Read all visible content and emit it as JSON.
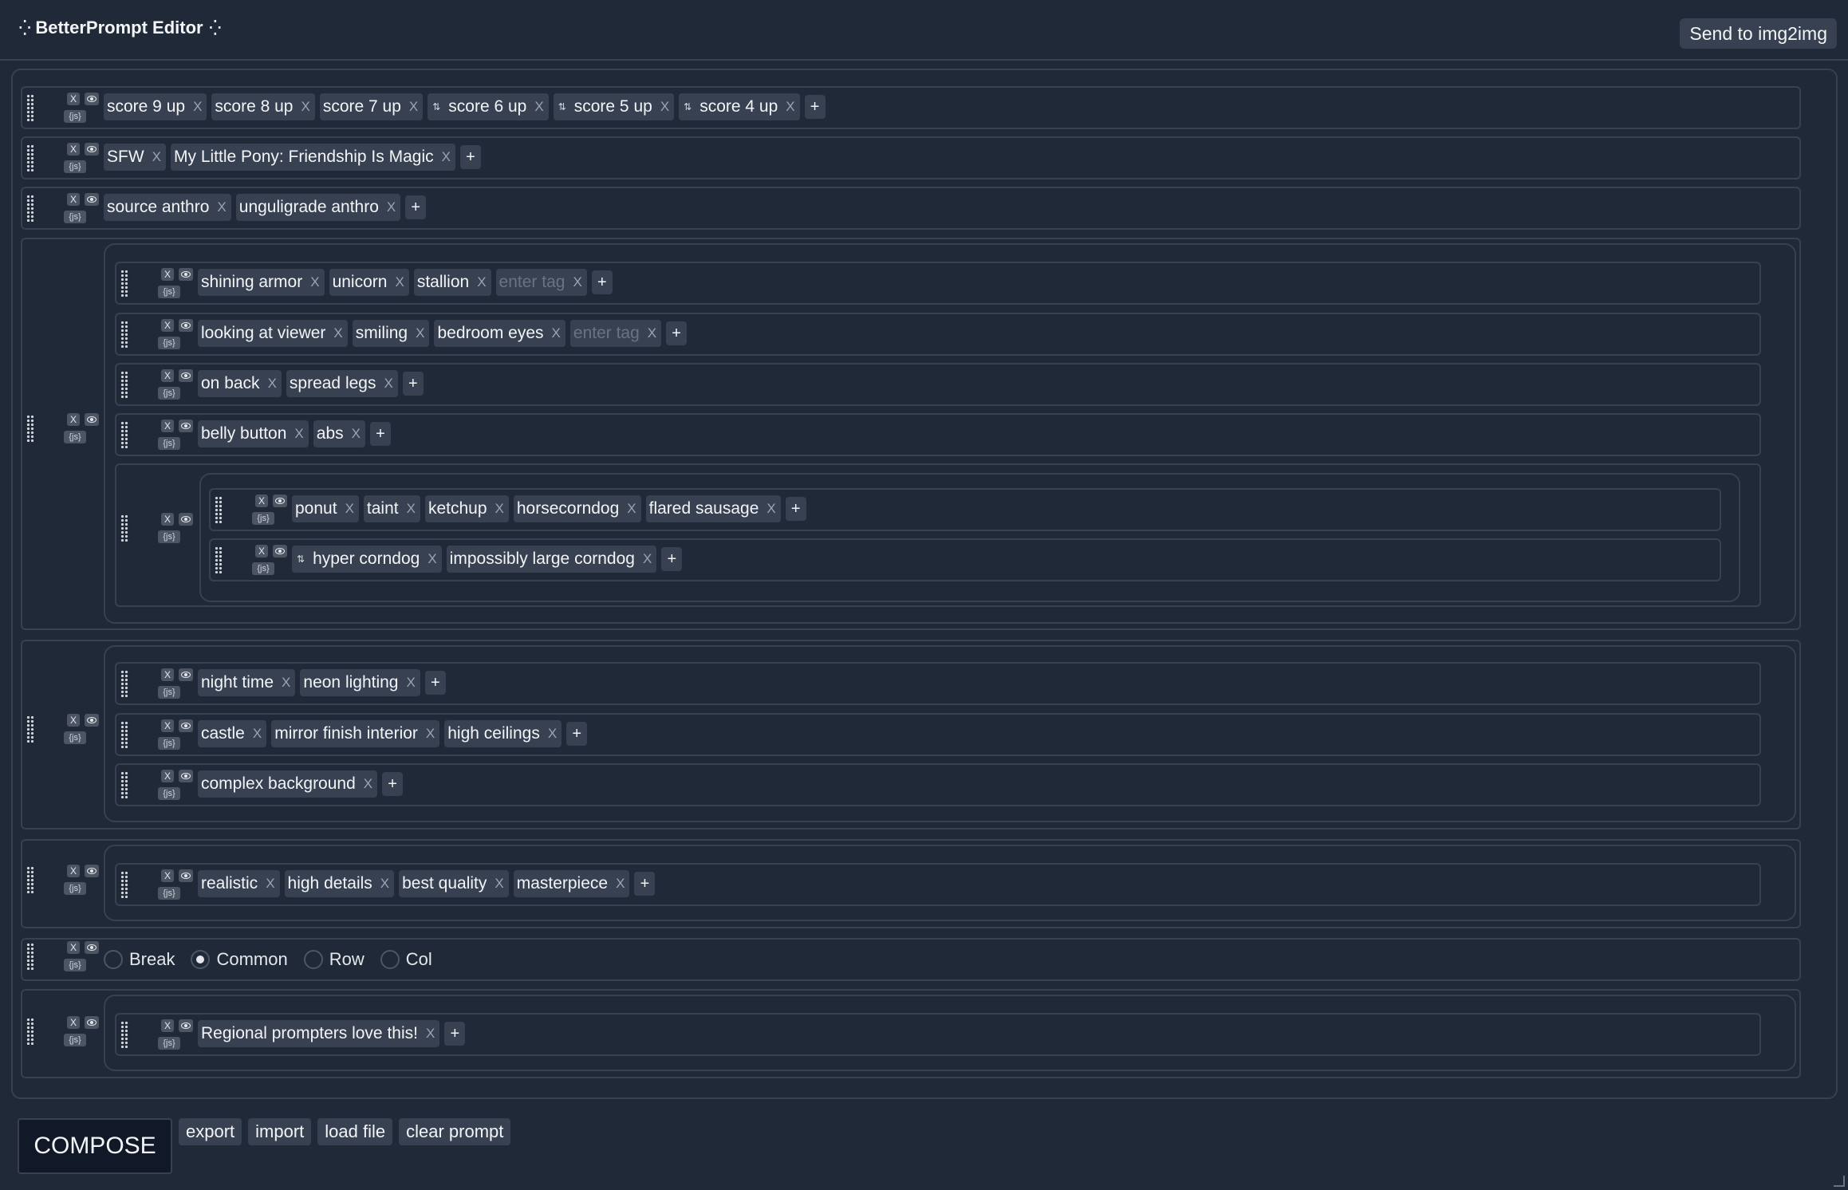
{
  "header": {
    "title": "BetterPrompt Editor",
    "send_button": "Send to img2img"
  },
  "controls": {
    "close": "X",
    "js": "{js}",
    "add": "+"
  },
  "rows": {
    "r1": [
      "score 9 up",
      "score 8 up",
      "score 7 up",
      "score 6 up",
      "score 5 up",
      "score 4 up"
    ],
    "r2": [
      "SFW",
      "My Little Pony: Friendship Is Magic"
    ],
    "r3": [
      "source anthro",
      "unguligrade anthro"
    ],
    "g1a": [
      "shining armor",
      "unicorn",
      "stallion",
      "enter tag"
    ],
    "g1b": [
      "looking at viewer",
      "smiling",
      "bedroom eyes",
      "enter tag"
    ],
    "g1c": [
      "on back",
      "spread legs"
    ],
    "g1d": [
      "belly button",
      "abs"
    ],
    "g1e1": [
      "ponut",
      "taint",
      "ketchup",
      "horsecorndog",
      "flared sausage"
    ],
    "g1e2": [
      "hyper corndog",
      "impossibly large corndog"
    ],
    "g2a": [
      "night time",
      "neon lighting"
    ],
    "g2b": [
      "castle",
      "mirror finish interior",
      "high ceilings"
    ],
    "g2c": [
      "complex background"
    ],
    "g3a": [
      "realistic",
      "high details",
      "best quality",
      "masterpiece"
    ],
    "g4a": [
      "Regional prompters love this!"
    ]
  },
  "break_options": [
    "Break",
    "Common",
    "Row",
    "Col"
  ],
  "break_selected": "Common",
  "footer": {
    "compose": "COMPOSE",
    "export": "export",
    "import": "import",
    "load_file": "load file",
    "clear_prompt": "clear prompt"
  }
}
